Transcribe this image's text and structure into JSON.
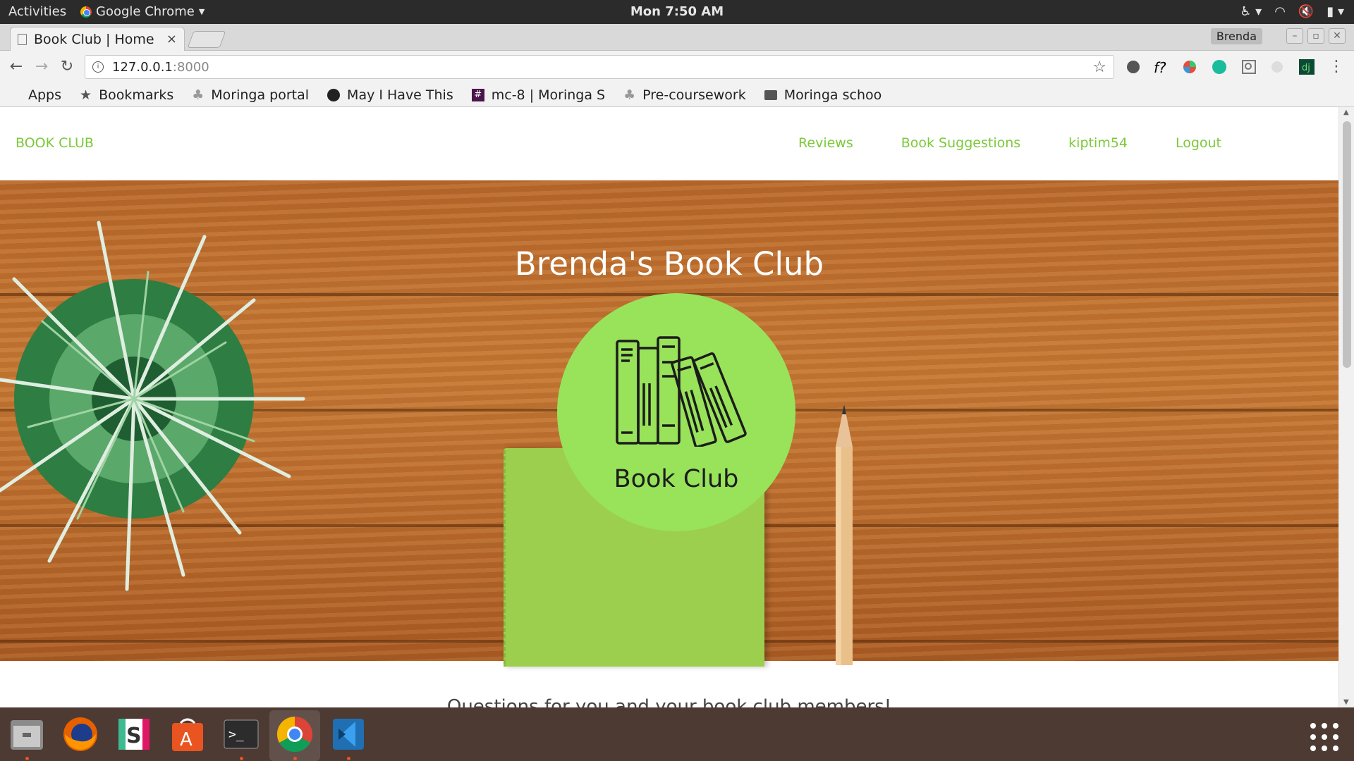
{
  "system": {
    "activities": "Activities",
    "app_name": "Google Chrome",
    "clock": "Mon  7:50 AM"
  },
  "browser": {
    "tab_title": "Book Club | Home",
    "tab_close": "×",
    "profile": "Brenda",
    "url_host": "127.0.0.1",
    "url_port": ":8000"
  },
  "bookmarks": [
    {
      "label": "Apps",
      "icon": "apps-grid-icon"
    },
    {
      "label": "Bookmarks",
      "icon": "star-icon"
    },
    {
      "label": "Moringa portal",
      "icon": "tree-icon"
    },
    {
      "label": "May I Have This",
      "icon": "spotify-icon"
    },
    {
      "label": "mc-8 | Moringa S",
      "icon": "slack-hash-icon"
    },
    {
      "label": "Pre-coursework",
      "icon": "tree-icon"
    },
    {
      "label": "Moringa schoo",
      "icon": "folder-icon"
    }
  ],
  "site": {
    "brand": "BOOK CLUB",
    "nav": [
      "Reviews",
      "Book Suggestions",
      "kiptim54",
      "Logout"
    ],
    "hero_title": "Brenda's Book Club",
    "logo_caption": "Book Club",
    "questions": "Questions for you and your book club members!"
  },
  "colors": {
    "accent_green": "#7cc93a",
    "logo_green": "#98e35a",
    "dock": "#4d3a33"
  }
}
